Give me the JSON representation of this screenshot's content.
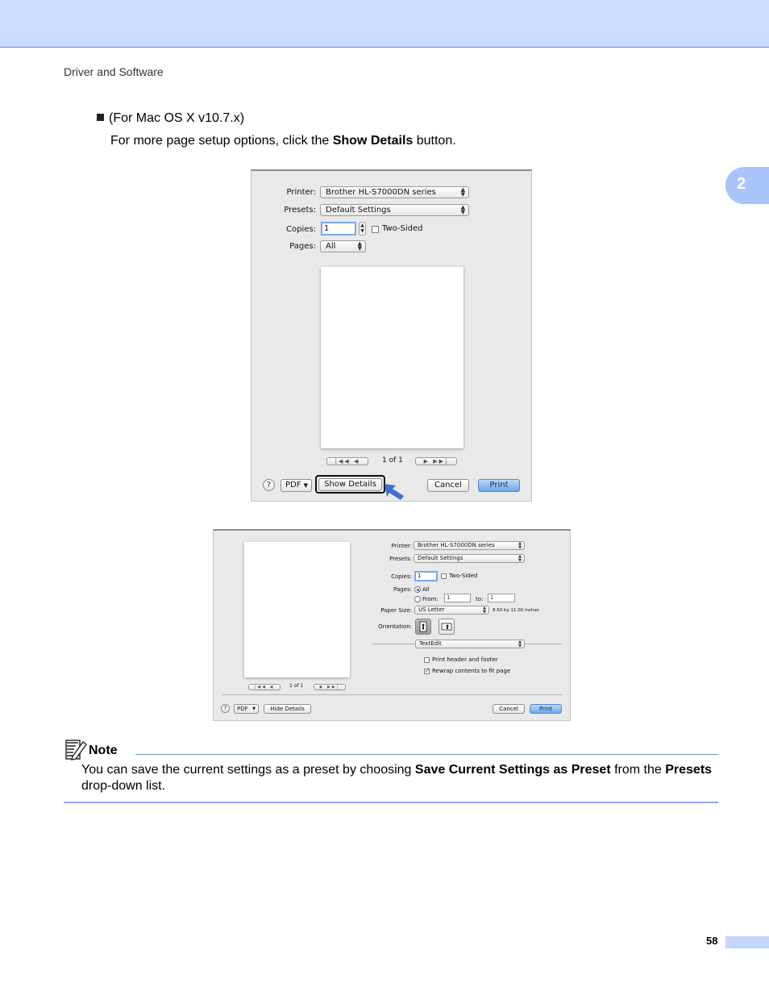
{
  "header": {
    "running_head": "Driver and Software",
    "chapter_number": "2"
  },
  "bullet": {
    "text": "(For Mac OS X v10.7.x)"
  },
  "instruction": {
    "before": "For more page setup options, click the ",
    "bold": "Show Details",
    "after": " button."
  },
  "dialog_simple": {
    "printer_label": "Printer:",
    "printer_value": "Brother HL-S7000DN series",
    "presets_label": "Presets:",
    "presets_value": "Default Settings",
    "copies_label": "Copies:",
    "copies_value": "1",
    "two_sided_label": "Two-Sided",
    "pages_label": "Pages:",
    "pages_value": "All",
    "page_count": "1 of 1",
    "help_label": "?",
    "pdf_label": "PDF",
    "show_details_label": "Show Details",
    "cancel_label": "Cancel",
    "print_label": "Print"
  },
  "dialog_details": {
    "printer_label": "Printer:",
    "printer_value": "Brother HL-S7000DN series",
    "presets_label": "Presets:",
    "presets_value": "Default Settings",
    "copies_label": "Copies:",
    "copies_value": "1",
    "two_sided_label": "Two-Sided",
    "pages_label": "Pages:",
    "pages_all_label": "All",
    "from_label": "From:",
    "from_value": "1",
    "to_label": "to:",
    "to_value": "1",
    "paper_size_label": "Paper Size:",
    "paper_size_value": "US Letter",
    "paper_size_dims": "8.50 by 11.00 inches",
    "orientation_label": "Orientation:",
    "app_section_value": "TextEdit",
    "print_header_footer_label": "Print header and footer",
    "rewrap_label": "Rewrap contents to fit page",
    "page_count": "1 of 1",
    "help_label": "?",
    "pdf_label": "PDF",
    "hide_details_label": "Hide Details",
    "cancel_label": "Cancel",
    "print_label": "Print"
  },
  "note": {
    "title": "Note",
    "text_1": "You can save the current settings as a preset by choosing ",
    "bold_1": "Save Current Settings as Preset",
    "text_2": " from the ",
    "bold_2": "Presets",
    "text_3": " drop-down list."
  },
  "footer": {
    "page_number": "58"
  },
  "colors": {
    "header_band": "#cbdcfd",
    "header_rule": "#5a86e4",
    "chapter_tab": "#a9c4f8",
    "note_rule": "#6f95e6",
    "arrow": "#3f6fd0"
  }
}
